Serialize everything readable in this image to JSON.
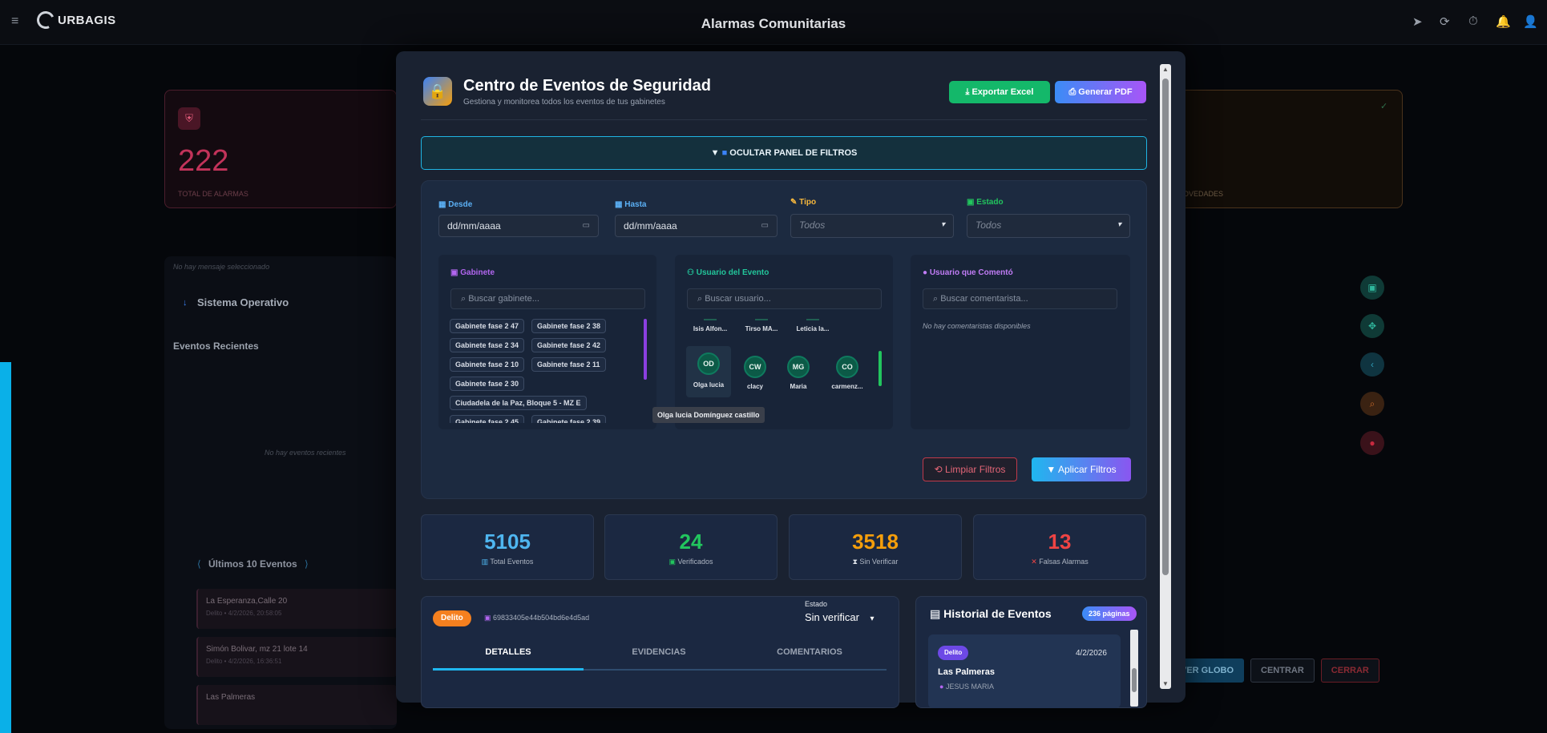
{
  "app": {
    "brand": "URBAGIS",
    "title": "Alarmas Comunitarias"
  },
  "background": {
    "total_alarmas_value": "222",
    "total_alarmas_label": "TOTAL DE ALARMAS",
    "novedades_label": "OVEDADES",
    "no_message": "No hay mensaje seleccionado",
    "sistema_operativo": "Sistema Operativo",
    "eventos_recientes": "Eventos Recientes",
    "no_eventos": "No hay eventos recientes",
    "ultimos": "Últimos 10 Eventos",
    "events": [
      {
        "title": "La Esperanza,Calle 20",
        "sub": "Delito • 4/2/2026, 20:58:05"
      },
      {
        "title": "Simón Bolivar, mz 21 lote 14",
        "sub": "Delito • 4/2/2026, 16:36:51"
      },
      {
        "title": "Las Palmeras",
        "sub": ""
      }
    ],
    "map_buttons": {
      "globe": "VER GLOBO",
      "center": "CENTRAR",
      "close": "CERRAR"
    }
  },
  "modal": {
    "title": "Centro de Eventos de Seguridad",
    "subtitle": "Gestiona y monitorea todos los eventos de tus gabinetes",
    "export_excel": "Exportar Excel",
    "generate_pdf": "Generar PDF",
    "toggle_filters": "OCULTAR PANEL DE FILTROS",
    "filters": {
      "desde_label": "Desde",
      "desde_value": "dd/mm/aaaa",
      "hasta_label": "Hasta",
      "hasta_value": "dd/mm/aaaa",
      "tipo_label": "Tipo",
      "tipo_value": "Todos",
      "estado_label": "Estado",
      "estado_value": "Todos",
      "gabinete": {
        "label": "Gabinete",
        "placeholder": "Buscar gabinete...",
        "chips": [
          "Gabinete fase 2 47",
          "Gabinete fase 2 38",
          "Gabinete fase 2 34",
          "Gabinete fase 2 42",
          "Gabinete fase 2 10",
          "Gabinete fase 2 11",
          "Gabinete fase 2 30",
          "Ciudadela de la Paz, Bloque 5 - MZ E",
          "Gabinete fase 2 45",
          "Gabinete fase 2 39"
        ]
      },
      "usuario_evento": {
        "label": "Usuario del Evento",
        "placeholder": "Buscar usuario...",
        "top_names": [
          "Isis Alfon...",
          "Tirso MA...",
          "Leticia la..."
        ],
        "avatars": [
          {
            "initials": "OD",
            "name": "Olga lucia"
          },
          {
            "initials": "CW",
            "name": "clacy"
          },
          {
            "initials": "MG",
            "name": "Maria"
          },
          {
            "initials": "CO",
            "name": "carmenz..."
          }
        ],
        "tooltip": "Olga lucia Domínguez castillo"
      },
      "usuario_comento": {
        "label": "Usuario que Comentó",
        "placeholder": "Buscar comentarista...",
        "empty": "No hay comentaristas disponibles"
      },
      "clear": "Limpiar Filtros",
      "apply": "Aplicar Filtros"
    },
    "stats": [
      {
        "value": "5105",
        "label": "Total Eventos",
        "color": "#4fb6f0"
      },
      {
        "value": "24",
        "label": "Verificados",
        "color": "#22c55e"
      },
      {
        "value": "3518",
        "label": "Sin Verificar",
        "color": "#f59e0b"
      },
      {
        "value": "13",
        "label": "Falsas Alarmas",
        "color": "#ef4444"
      }
    ],
    "detail": {
      "badge": "Delito",
      "id": "69833405e44b504bd6e4d5ad",
      "estado_label": "Estado",
      "estado_value": "Sin verificar",
      "tabs": [
        "DETALLES",
        "EVIDENCIAS",
        "COMENTARIOS"
      ]
    },
    "historial": {
      "title": "Historial de Eventos",
      "pages": "236 páginas",
      "item_badge": "Delito",
      "item_date": "4/2/2026",
      "item_title": "Las Palmeras",
      "item_sub": "JESUS MARIA"
    }
  }
}
